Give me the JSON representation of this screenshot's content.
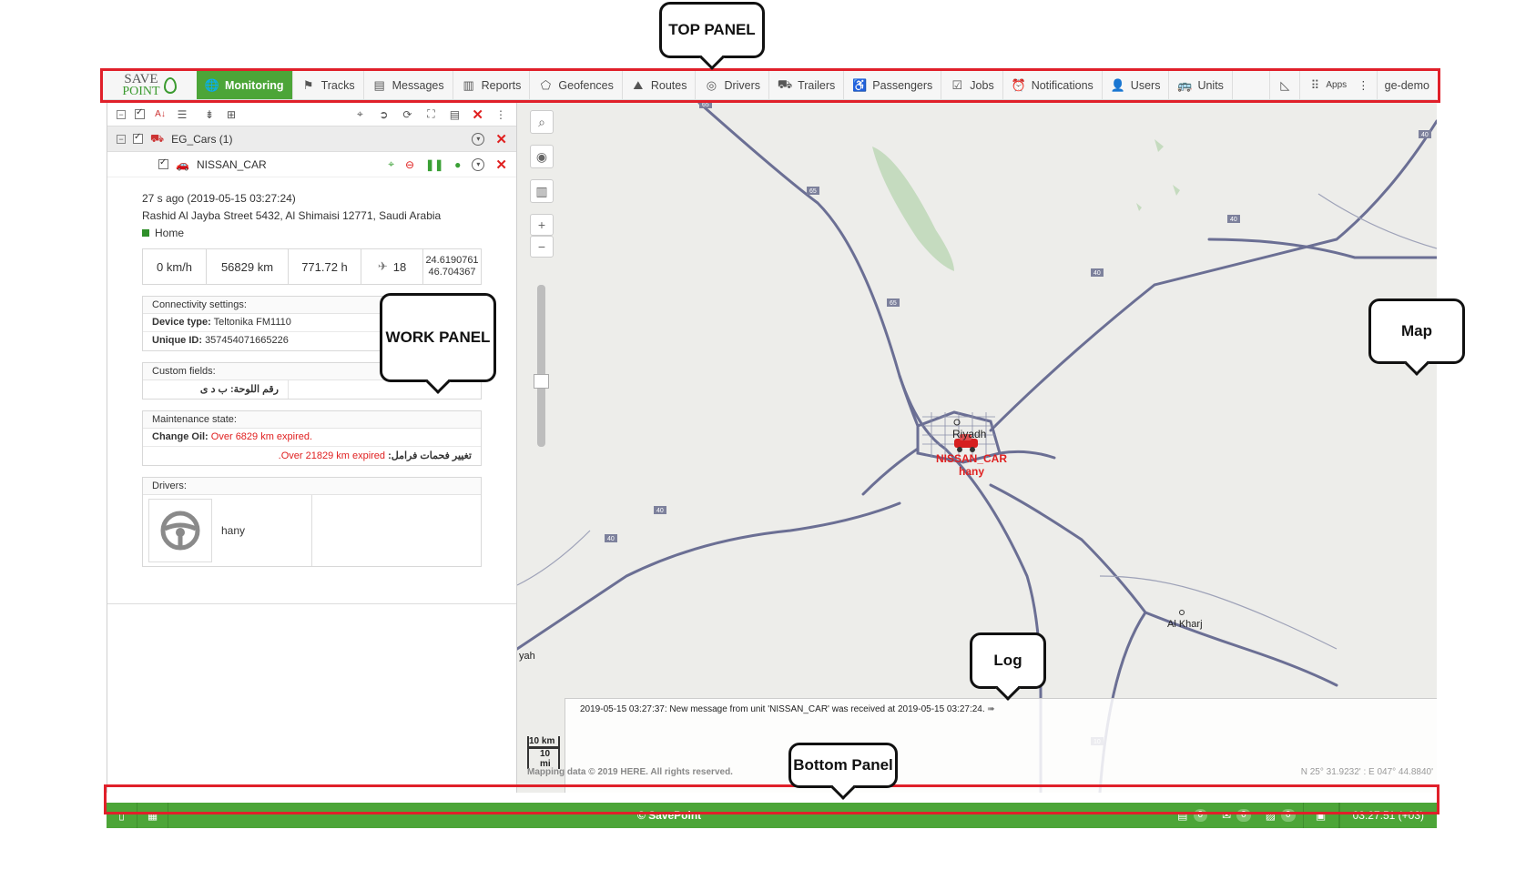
{
  "annotations": {
    "top_panel": "TOP PANEL",
    "work_panel": "WORK PANEL",
    "map": "Map",
    "log": "Log",
    "bottom_panel": "Bottom Panel"
  },
  "logo": {
    "line1": "SAVE",
    "line2": "POINT"
  },
  "nav": {
    "items": [
      {
        "label": "Monitoring",
        "icon": "globe-icon",
        "active": true
      },
      {
        "label": "Tracks",
        "icon": "flag-icon"
      },
      {
        "label": "Messages",
        "icon": "messages-icon"
      },
      {
        "label": "Reports",
        "icon": "reports-icon"
      },
      {
        "label": "Geofences",
        "icon": "geofence-icon"
      },
      {
        "label": "Routes",
        "icon": "routes-icon"
      },
      {
        "label": "Drivers",
        "icon": "steering-wheel-icon"
      },
      {
        "label": "Trailers",
        "icon": "trailer-icon"
      },
      {
        "label": "Passengers",
        "icon": "passenger-icon"
      },
      {
        "label": "Jobs",
        "icon": "clipboard-icon"
      },
      {
        "label": "Notifications",
        "icon": "alarm-icon"
      },
      {
        "label": "Users",
        "icon": "user-icon"
      },
      {
        "label": "Units",
        "icon": "bus-icon"
      }
    ],
    "apps_label": "Apps",
    "account": "ge-demo"
  },
  "work_panel": {
    "group": {
      "name": "EG_Cars (1)"
    },
    "unit": {
      "name": "NISSAN_CAR",
      "last_message": "27 s ago (2019-05-15 03:27:24)",
      "address": "Rashid Al Jayba Street 5432, Al Shimaisi 12771, Saudi Arabia",
      "geofence": "Home",
      "speed": "0 km/h",
      "mileage": "56829 km",
      "engine_hours": "771.72 h",
      "satellites": "18",
      "lat": "24.6190761",
      "lon": "46.704367"
    },
    "connectivity": {
      "title": "Connectivity settings:",
      "device_type_label": "Device type:",
      "device_type_value": "Teltonika FM1110",
      "unique_id_label": "Unique ID:",
      "unique_id_value": "357454071665226"
    },
    "custom_fields": {
      "title": "Custom fields:",
      "row": "رقم اللوحة: ب د ى"
    },
    "maintenance": {
      "title": "Maintenance state:",
      "oil_label": "Change Oil:",
      "oil_value": "Over 6829 km expired.",
      "brake_label": "تغيير فحمات فرامل:",
      "brake_value": "Over 21829 km expired."
    },
    "drivers": {
      "title": "Drivers:",
      "name": "hany"
    }
  },
  "map": {
    "city_riyadh": "Riyadh",
    "city_alkharj": "Al Kharj",
    "city_partial": "yah",
    "unit_label": "NISSAN_CAR",
    "driver_label": "hany",
    "scale_km": "10 km",
    "scale_mi": "10 mi",
    "copyright": "Mapping data © 2019 HERE. All rights reserved.",
    "coordinates": "N 25° 31.9232' : E 047° 44.8840'",
    "road_labels": [
      "65",
      "65",
      "65",
      "40",
      "40",
      "40",
      "40",
      "40",
      "10"
    ]
  },
  "log": {
    "message": "2019-05-15 03:27:37: New message from unit 'NISSAN_CAR' was received at 2019-05-15 03:27:24."
  },
  "bottom": {
    "copyright": "© SavePoint",
    "counters": [
      "0",
      "0",
      "0"
    ],
    "time": "03:27:51 (+03)"
  },
  "colors": {
    "brand_green": "#4ca538",
    "frame_red": "#e0202a",
    "expired_red": "#e02020",
    "road_color": "#6b6f94"
  }
}
